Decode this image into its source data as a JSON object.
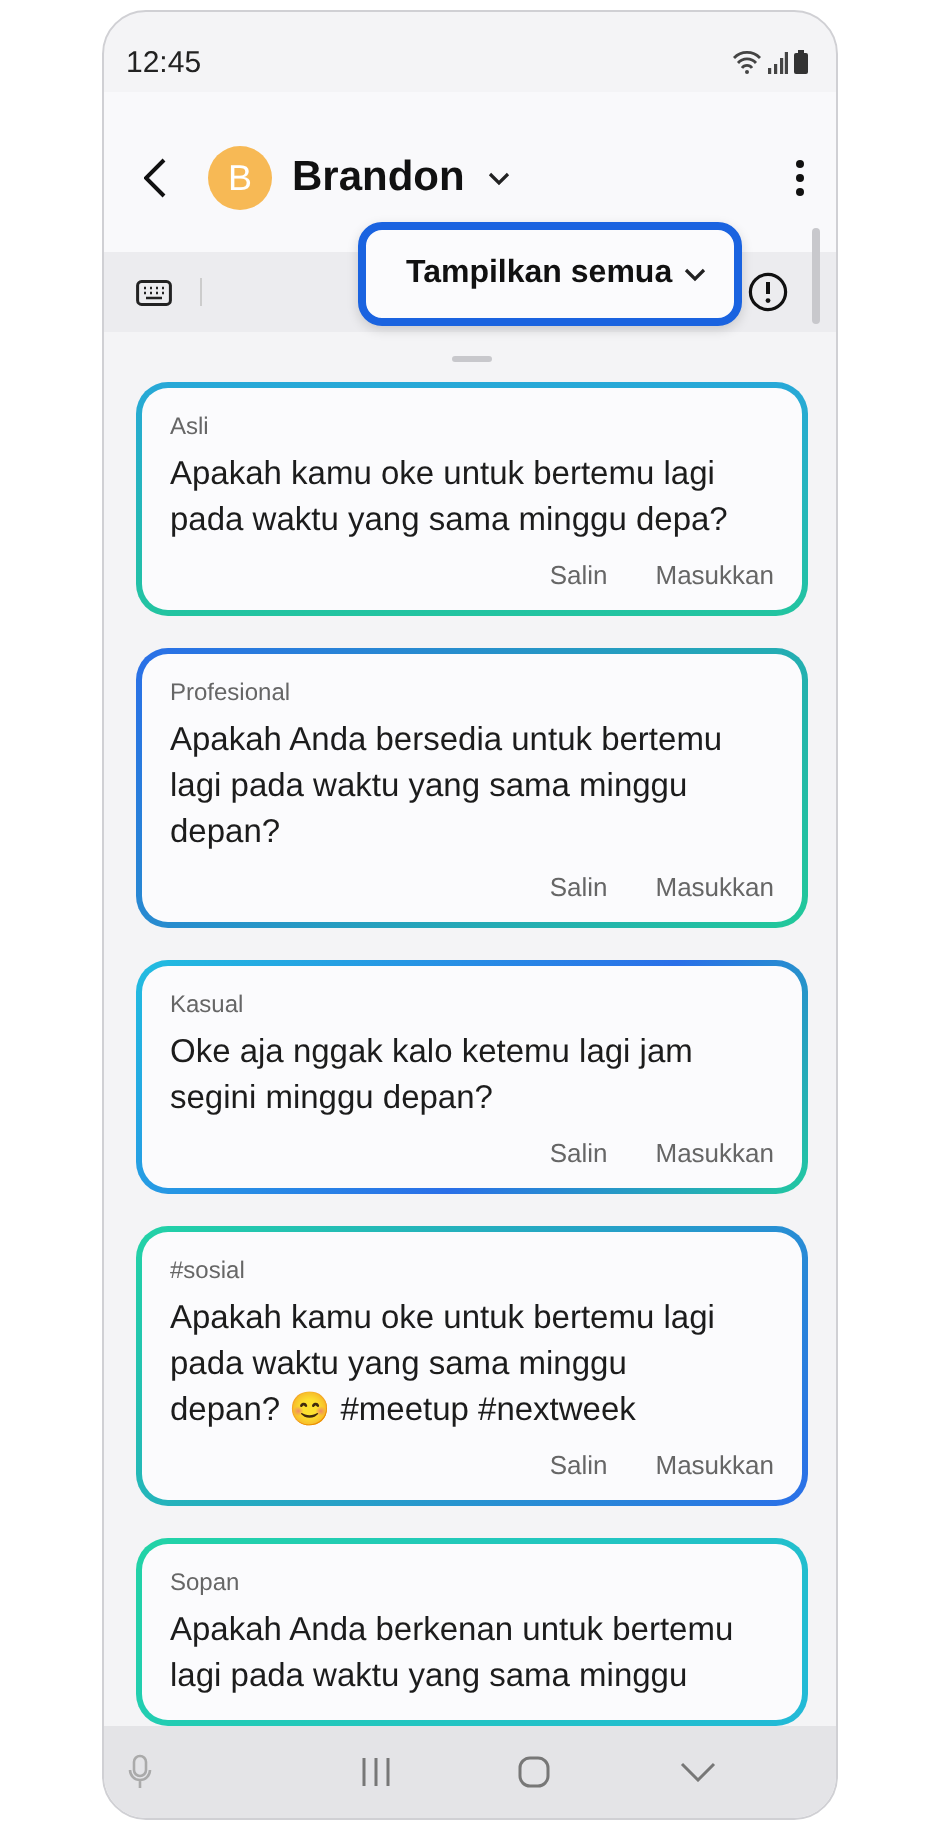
{
  "status_bar": {
    "time": "12:45"
  },
  "header": {
    "contact_name": "Brandon",
    "avatar_letter": "B"
  },
  "toolbar": {
    "filter": {
      "label": "Tampilkan semua",
      "focused": true
    }
  },
  "suggestions": [
    {
      "tone": "Asli",
      "text": "Apakah kamu oke untuk bertemu lagi pada waktu yang sama minggu depa?",
      "actions": [
        "Salin",
        "Masukkan"
      ]
    },
    {
      "tone": "Profesional",
      "text": "Apakah Anda bersedia untuk bertemu lagi pada waktu yang sama minggu depan?",
      "actions": [
        "Salin",
        "Masukkan"
      ]
    },
    {
      "tone": "Kasual",
      "text": "Oke aja nggak kalo ketemu lagi jam segini minggu depan?",
      "actions": [
        "Salin",
        "Masukkan"
      ]
    },
    {
      "tone": "#sosial",
      "text": "Apakah kamu oke untuk bertemu lagi pada waktu yang sama minggu depan? 😊 #meetup #nextweek",
      "actions": [
        "Salin",
        "Masukkan"
      ]
    },
    {
      "tone": "Sopan",
      "text": "Apakah Anda berkenan untuk bertemu lagi pada waktu yang sama minggu"
    }
  ]
}
